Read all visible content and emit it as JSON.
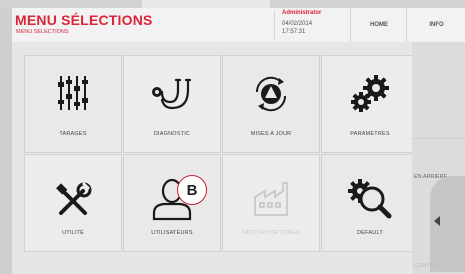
{
  "header": {
    "title": "MENU SÉLECTIONS",
    "subtitle": "MENU SELECTIONS",
    "user": "Administrator",
    "date": "04/02/2014",
    "time": "17:57:31",
    "home_label": "HOME",
    "info_label": "INFO"
  },
  "tiles": [
    {
      "label": "TARAGES",
      "icon": "sliders-icon"
    },
    {
      "label": "DIAGNOSTIC",
      "icon": "stethoscope-icon"
    },
    {
      "label": "MISES A JOUR",
      "icon": "update-icon"
    },
    {
      "label": "PARAMÈTRES",
      "icon": "gears-icon"
    },
    {
      "label": "UTILITÉ",
      "icon": "tools-icon"
    },
    {
      "label": "UTILISATEURS",
      "icon": "user-icon"
    },
    {
      "label": "FACTORY SETTINGS",
      "icon": "factory-icon"
    },
    {
      "label": "DEFAULT",
      "icon": "default-search-icon"
    }
  ],
  "side": {
    "back_label": "EN ARRIERE",
    "continue_label": "CONTINU"
  },
  "callout": {
    "label": "B"
  },
  "colors": {
    "accent": "#d8263a",
    "icon": "#1a1a1a",
    "disabled": "#c8c8c8"
  }
}
